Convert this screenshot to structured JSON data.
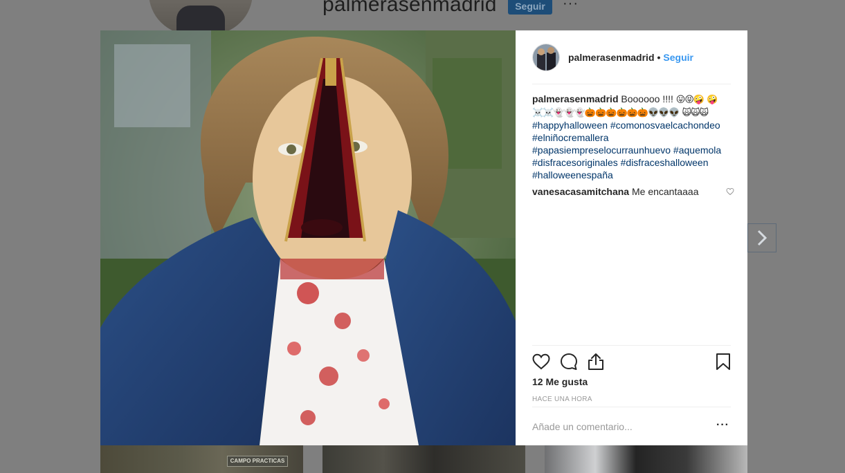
{
  "background": {
    "username": "palmerasenmadrid",
    "follow_label": "Seguir",
    "more_label": "···",
    "sign_text": "CAMPO PRACTICAS"
  },
  "post": {
    "username": "palmerasenmadrid",
    "separator": "•",
    "follow_label": "Seguir",
    "caption": {
      "username": "palmerasenmadrid",
      "text": "Boooooo !!!!",
      "emojis_1": "😛😝🤪",
      "emojis_2": "🤪☠️☠️👻👻👻🎃🎃🎃🎃🎃🎃👽👽👽",
      "emojis_3": "🙀🙀🙀",
      "hashtags": [
        "#happyhalloween",
        "#comonosvaelcachondeo",
        "#elniñocremallera",
        "#papasiempreselocurraunhuevo",
        "#aquemola",
        "#disfracesoriginales",
        "#disfraceshalloween",
        "#halloweenespaña"
      ]
    },
    "comment": {
      "username": "vanesacasamitchana",
      "text": "Me encantaaaa"
    },
    "likes": "12 Me gusta",
    "time": "HACE UNA HORA",
    "comment_placeholder": "Añade un comentario...",
    "more_label": "···"
  },
  "colors": {
    "link": "#003569",
    "follow": "#3897f0",
    "text": "#262626",
    "muted": "#999999"
  },
  "icons": [
    "heart-icon",
    "comment-icon",
    "share-icon",
    "bookmark-icon",
    "chevron-right-icon"
  ]
}
